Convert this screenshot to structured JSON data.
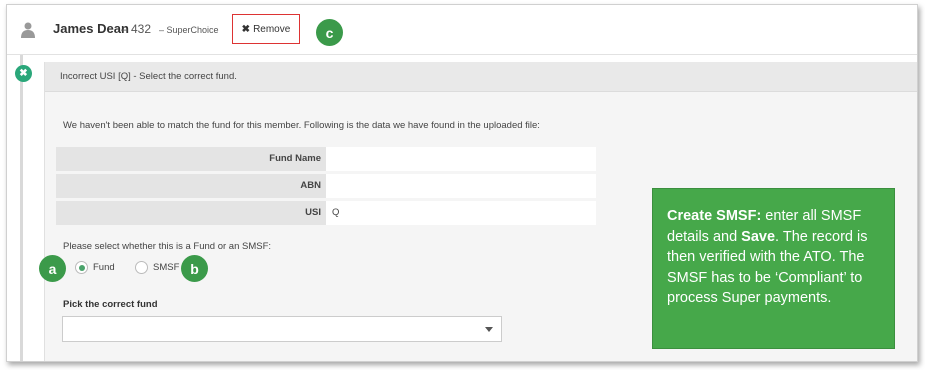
{
  "member": {
    "name": "James Dean",
    "id": "– 432",
    "fund": "– SuperChoice",
    "remove_icon": "✖",
    "remove_label": "Remove"
  },
  "callouts": {
    "a": "a",
    "b": "b",
    "c": "c"
  },
  "error": {
    "icon": "✖",
    "message": "Incorrect USI [Q] - Select the correct fund."
  },
  "intro": "We haven't been able to match the fund for this member. Following is the data we have found in the uploaded file:",
  "fields": [
    {
      "label": "Fund Name",
      "value": ""
    },
    {
      "label": "ABN",
      "value": ""
    },
    {
      "label": "USI",
      "value": "Q"
    }
  ],
  "fund_type": {
    "prompt": "Please select whether this is a Fund or an SMSF:",
    "options": [
      {
        "label": "Fund",
        "selected": true
      },
      {
        "label": "SMSF",
        "selected": false
      }
    ]
  },
  "pick": {
    "label": "Pick the correct fund",
    "value": ""
  },
  "note": {
    "title": "Create SMSF:",
    "text1": " enter all SMSF details and ",
    "save": "Save",
    "text2": ". The record is then verified with the ATO. The SMSF has to be ‘Compliant’ to process  Super payments."
  },
  "colors": {
    "accent": "#46a84a",
    "error_dot": "#2aa77a",
    "remove_border": "#dd3333"
  },
  "icons": {
    "member": "person-icon",
    "error": "close-icon",
    "dropdown": "chevron-down-icon"
  }
}
